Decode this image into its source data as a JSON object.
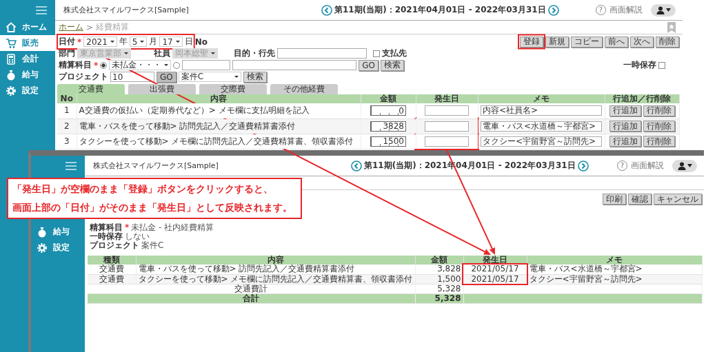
{
  "top_screen": {
    "sidebar": {
      "items": [
        {
          "label": "ホーム",
          "selected": false
        },
        {
          "label": "販売",
          "selected": true
        },
        {
          "label": "会計",
          "selected": false
        },
        {
          "label": "給与",
          "selected": false
        },
        {
          "label": "設定",
          "selected": false
        }
      ]
    },
    "header": {
      "company": "株式会社スマイルワークス[Sample]",
      "period": "第11期(当期)：2021年04月01日 - 2022年03月31日",
      "help_mark": "?",
      "help": "画面解説"
    },
    "breadcrumb": {
      "home": "ホーム",
      "separator": ">",
      "current": "経費精算"
    },
    "date": {
      "label": "日付",
      "mark": "*",
      "parts": [
        {
          "kind": "select",
          "text": "2021"
        },
        {
          "kind": "unit",
          "text": "年"
        },
        {
          "kind": "select",
          "text": "5"
        },
        {
          "kind": "unit",
          "text": "月"
        },
        {
          "kind": "select",
          "text": "17"
        },
        {
          "kind": "unit",
          "text": "日"
        }
      ],
      "no_label": "No"
    },
    "toolbar": [
      "登録",
      "新規",
      "コピー",
      "前へ",
      "次へ",
      "削除"
    ],
    "department": {
      "label": "部門",
      "value": "東京営業部",
      "disabled": true
    },
    "employee": {
      "label": "社員",
      "value": "岡本総聖",
      "disabled": true
    },
    "purpose": {
      "label": "目的・行先"
    },
    "payee": {
      "label": "支払先",
      "checked": false
    },
    "account": {
      "label": "精算科目",
      "mark": "*",
      "options": [
        {
          "kind": "select",
          "selected": true,
          "value": "未払金・・・"
        },
        {
          "kind": "input",
          "selected": false
        }
      ],
      "go": "GO",
      "search": "検索"
    },
    "temp_save": {
      "label": "一時保存",
      "checked": false
    },
    "project": {
      "label": "プロジェクト",
      "code": "10",
      "go": "GO",
      "name": "案件C",
      "search": "検索"
    },
    "tabs": [
      {
        "label": "交通費",
        "selected": true
      },
      {
        "label": "出張費",
        "selected": false
      },
      {
        "label": "交際費",
        "selected": false
      },
      {
        "label": "その他経費",
        "selected": false
      }
    ],
    "table": {
      "columns": [
        "No",
        "内容",
        "金額",
        "発生日",
        "メモ",
        "行追加／行削除"
      ],
      "rows": [
        {
          "no": "1",
          "content": "A交通費の仮払い（定期券代など）> メモ欄に支払明細を記入",
          "amount": "0",
          "memo": "内容<社員名>",
          "add": "行追加",
          "delete": "行削除"
        },
        {
          "no": "2",
          "content": "電車・バスを使って移動> 訪問先記入／交通費精算書添付",
          "amount": "3828",
          "memo": "電車・バス<水道橋～宇都宮>",
          "add": "行追加",
          "delete": "行削除"
        },
        {
          "no": "3",
          "content": "タクシーを使って移動> メモ欄に訪問先記入／交通費精算書、領収書添付",
          "amount": "1500",
          "memo": "タクシー<宇留野宮～訪問先>",
          "add": "行追加",
          "delete": "行削除"
        }
      ]
    }
  },
  "bottom_screen": {
    "sidebar": {
      "items": [
        {
          "label": "給与",
          "selected": false
        },
        {
          "label": "設定",
          "selected": false
        }
      ]
    },
    "header": {
      "company": "株式会社スマイルワークス[Sample]",
      "period": "第11期(当期)：2021年04月01日 - 2022年03月31日",
      "help_mark": "?",
      "help": "画面解説"
    },
    "buttons": [
      "印刷",
      "確認",
      "キャンセル"
    ],
    "details": [
      {
        "label": "精算科目",
        "mark": "*",
        "value": "未払金 - 社内経費精算"
      },
      {
        "label": "一時保存",
        "value": "しない"
      },
      {
        "label": "プロジェクト",
        "value": "案件C"
      }
    ],
    "table": {
      "columns": [
        "種類",
        "内容",
        "金額",
        "発生日",
        "メモ"
      ],
      "rows": [
        {
          "kind": "item",
          "type": "交通費",
          "content": "電車・バスを使って移動> 訪問先記入／交通費精算書添付",
          "amount": "3,828",
          "date": "2021/05/17",
          "memo": "電車・バス<水道橋～宇都宮>"
        },
        {
          "kind": "item",
          "type": "交通費",
          "content": "タクシーを使って移動> メモ欄に訪問先記入／交通費精算書、領収書添付",
          "amount": "1,500",
          "date": "2021/05/17",
          "memo": "タクシー<宇留野宮～訪問先>"
        },
        {
          "kind": "subtotal",
          "label": "交通費計",
          "amount": "5,328"
        },
        {
          "kind": "total",
          "label": "合計",
          "amount": "5,328"
        }
      ]
    }
  },
  "annotation": {
    "lines": [
      "「発生日」が空欄のまま「登録」ボタンをクリックすると、",
      "画面上部の「日付」がそのまま「発生日」として反映されます。"
    ]
  }
}
